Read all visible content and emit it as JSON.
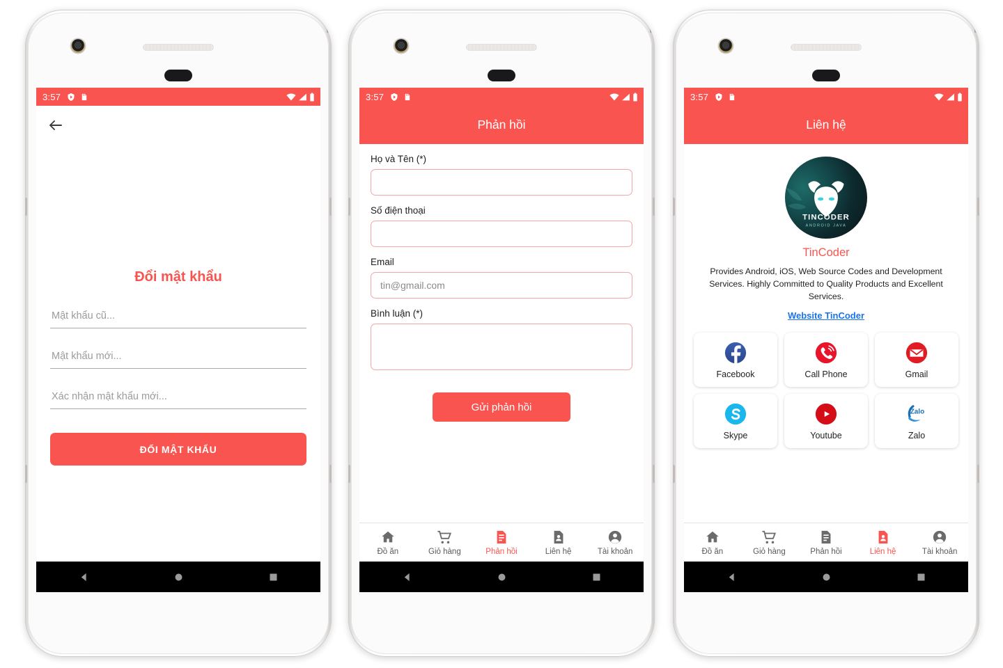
{
  "theme": {
    "accent": "#f9544f",
    "link": "#1a73e8",
    "border_pink": "#f2a7a4"
  },
  "status_bar": {
    "time": "3:57",
    "icons": [
      "shield-icon",
      "sd-card-icon",
      "wifi-icon",
      "signal-icon",
      "battery-icon"
    ]
  },
  "android_nav": {
    "back": "back-triangle-icon",
    "home": "home-circle-icon",
    "recents": "recents-square-icon"
  },
  "screens": [
    {
      "id": "change-password",
      "topbar": {
        "type": "plain",
        "back_icon": "arrow-left-icon",
        "title": ""
      },
      "title": "Đổi mật khẩu",
      "fields": [
        {
          "name": "old-password",
          "placeholder": "Mật khẩu cũ...",
          "value": ""
        },
        {
          "name": "new-password",
          "placeholder": "Mật khẩu mới...",
          "value": ""
        },
        {
          "name": "confirm-password",
          "placeholder": "Xác nhận mật khẩu mới...",
          "value": ""
        }
      ],
      "submit_label": "ĐỔI MẬT KHẨU"
    },
    {
      "id": "feedback",
      "topbar": {
        "type": "accent",
        "title": "Phản hồi"
      },
      "fields": [
        {
          "name": "full-name",
          "label": "Họ và Tên (*)",
          "placeholder": "",
          "value": "",
          "multiline": false
        },
        {
          "name": "phone-number",
          "label": "Số điện thoại",
          "placeholder": "",
          "value": "",
          "multiline": false
        },
        {
          "name": "email",
          "label": "Email",
          "placeholder": "tin@gmail.com",
          "value": "",
          "multiline": false
        },
        {
          "name": "comment",
          "label": "Bình luận (*)",
          "placeholder": "",
          "value": "",
          "multiline": true
        }
      ],
      "submit_label": "Gửi phản hồi"
    },
    {
      "id": "contact",
      "topbar": {
        "type": "accent",
        "title": "Liên hệ"
      },
      "logo": {
        "icon": "tincoder-bull-logo",
        "wordmark": "TINCODER",
        "subtitle": "ANDROID JAVA"
      },
      "company_name": "TinCoder",
      "description": "Provides Android, iOS, Web Source Codes and Development Services. Highly Committed to Quality Products and Excellent Services.",
      "website_link": "Website TinCoder",
      "social_cards": [
        {
          "icon": "facebook-icon",
          "label": "Facebook"
        },
        {
          "icon": "call-phone-icon",
          "label": "Call Phone"
        },
        {
          "icon": "gmail-icon",
          "label": "Gmail"
        },
        {
          "icon": "skype-icon",
          "label": "Skype"
        },
        {
          "icon": "youtube-icon",
          "label": "Youtube"
        },
        {
          "icon": "zalo-icon",
          "label": "Zalo"
        }
      ]
    }
  ],
  "tabbar": {
    "items": [
      {
        "icon": "home-icon",
        "label": "Đồ ăn"
      },
      {
        "icon": "cart-icon",
        "label": "Giỏ hàng"
      },
      {
        "icon": "feedback-doc-icon",
        "label": "Phản hồi"
      },
      {
        "icon": "contact-card-icon",
        "label": "Liên hệ"
      },
      {
        "icon": "account-icon",
        "label": "Tài khoản"
      }
    ],
    "active_feedback_index": 2,
    "active_contact_index": 3
  }
}
